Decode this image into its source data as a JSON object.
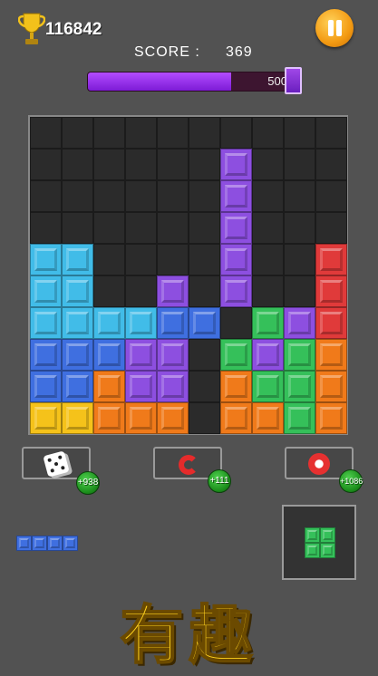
{
  "header": {
    "best_score": "116842",
    "score_label": "SCORE :",
    "score_value": "369"
  },
  "progress": {
    "target": "500",
    "fraction": 0.68,
    "color": "#9b35f0"
  },
  "board": {
    "size": 10,
    "colors": {
      "c": "#41bce8",
      "b": "#3f6fe0",
      "p": "#8d4fe0",
      "g": "#35c05a",
      "r": "#e03a3a",
      "o": "#f07a1a",
      "y": "#f5c21a"
    },
    "rows": [
      "..........",
      "......p...",
      "......p...",
      "......p...",
      "cc....p..r",
      "cc..p.p..r",
      "ccccbb.gprr",
      "bbbpp.gpgo",
      "bbopp.oggo",
      "yyooo.oogo"
    ]
  },
  "powerups": [
    {
      "name": "dice",
      "count": "+938"
    },
    {
      "name": "magnet",
      "count": "+111"
    },
    {
      "name": "bomb",
      "count": "+1086"
    }
  ],
  "next_pieces": {
    "left_color": "#3f6fe0",
    "right_color": "#35c05a"
  },
  "title": "有趣"
}
